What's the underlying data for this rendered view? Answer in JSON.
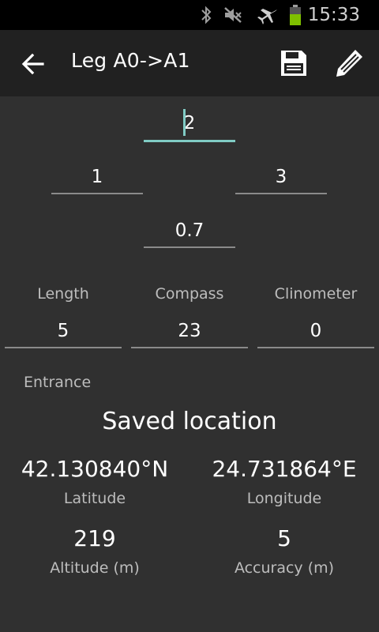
{
  "status_bar": {
    "time": "15:33",
    "icons": [
      "bluetooth-icon",
      "mute-icon",
      "airplane-mode-icon",
      "battery-icon"
    ],
    "battery_color": "#7fc000"
  },
  "toolbar": {
    "title": "Leg A0->A1",
    "back_icon": "arrow-left-icon",
    "save_icon": "save-icon",
    "edit_icon": "edit-icon"
  },
  "cross_section": {
    "up": "2",
    "left": "1",
    "right": "3",
    "down": "0.7"
  },
  "measurements": {
    "length_label": "Length",
    "compass_label": "Compass",
    "clinometer_label": "Clinometer",
    "length_value": "5",
    "compass_value": "23",
    "clinometer_value": "0"
  },
  "location": {
    "entrance_label": "Entrance",
    "heading": "Saved location",
    "latitude_value": "42.130840°N",
    "latitude_label": "Latitude",
    "longitude_value": "24.731864°E",
    "longitude_label": "Longitude",
    "altitude_value": "219",
    "altitude_label": "Altitude (m)",
    "accuracy_value": "5",
    "accuracy_label": "Accuracy (m)"
  },
  "colors": {
    "background": "#303030",
    "toolbar": "#212121",
    "accent": "#80cbc4",
    "underline": "#8a8a8a"
  }
}
